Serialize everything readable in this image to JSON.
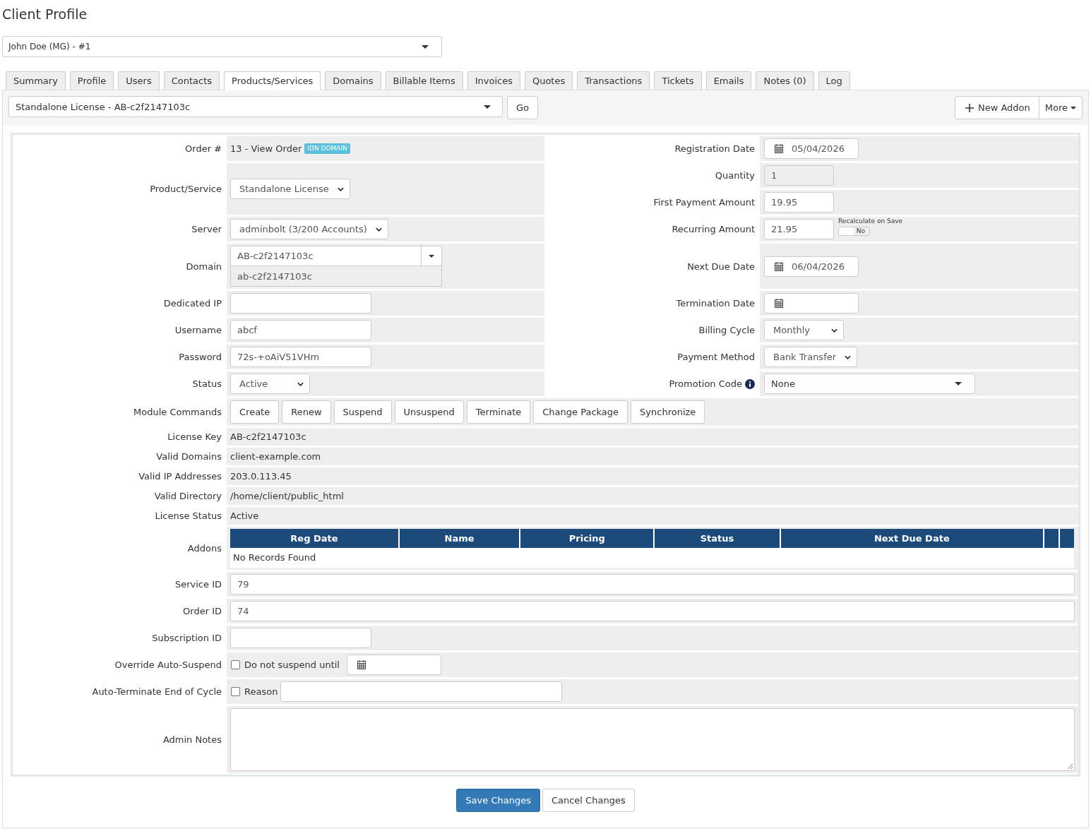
{
  "page_title": "Client Profile",
  "client_select": {
    "value": "John Doe (MG) - #1"
  },
  "tabs": [
    {
      "label": "Summary",
      "selected": false
    },
    {
      "label": "Profile",
      "selected": false
    },
    {
      "label": "Users",
      "selected": false
    },
    {
      "label": "Contacts",
      "selected": false
    },
    {
      "label": "Products/Services",
      "selected": true
    },
    {
      "label": "Domains",
      "selected": false
    },
    {
      "label": "Billable Items",
      "selected": false
    },
    {
      "label": "Invoices",
      "selected": false
    },
    {
      "label": "Quotes",
      "selected": false
    },
    {
      "label": "Transactions",
      "selected": false
    },
    {
      "label": "Tickets",
      "selected": false
    },
    {
      "label": "Emails",
      "selected": false
    },
    {
      "label": "Notes (0)",
      "selected": false
    },
    {
      "label": "Log",
      "selected": false
    }
  ],
  "service_bar": {
    "service_select": {
      "value": "Standalone License - AB-c2f2147103c"
    },
    "go_button": "Go",
    "new_addon_button": "New Addon",
    "more_button": "More"
  },
  "form": {
    "paired_rows": [
      {
        "left": {
          "label": "Order #",
          "kind": "order",
          "value": "13 -",
          "link": "View Order",
          "badge": "IDN DOMAIN"
        },
        "right": [
          {
            "label": "Registration Date",
            "kind": "date",
            "value": "05/04/2026"
          }
        ]
      },
      {
        "left": {
          "label": "Product/Service",
          "kind": "select",
          "value": "Standalone License"
        },
        "right": [
          {
            "label": "Quantity",
            "kind": "amount",
            "value": "1",
            "disabled": true
          },
          {
            "label": "First Payment Amount",
            "kind": "amount",
            "value": "19.95",
            "disabled": false
          }
        ]
      },
      {
        "left": {
          "label": "Server",
          "kind": "select",
          "value": "adminbolt (3/200 Accounts)"
        },
        "right": [
          {
            "label": "Recurring Amount",
            "kind": "amount",
            "value": "21.95",
            "disabled": false,
            "recalculate": {
              "label": "Recalculate on Save",
              "on": false,
              "state_text": "No"
            }
          }
        ]
      },
      {
        "left": {
          "label": "Domain",
          "kind": "domain",
          "value": "AB-c2f2147103c",
          "secondary_value": "ab-c2f2147103c"
        },
        "right": [
          {
            "label": "Next Due Date",
            "kind": "date",
            "value": "06/04/2026"
          }
        ]
      },
      {
        "left": {
          "label": "Dedicated IP",
          "kind": "text"
        },
        "right": [
          {
            "label": "Termination Date",
            "kind": "date"
          }
        ]
      },
      {
        "left": {
          "label": "Username",
          "kind": "text",
          "value": "abcf"
        },
        "right": [
          {
            "label": "Billing Cycle",
            "kind": "select",
            "value": "Monthly"
          }
        ]
      },
      {
        "left": {
          "label": "Password",
          "kind": "text",
          "value": "72s-+oAiV51VHm"
        },
        "right": [
          {
            "label": "Payment Method",
            "kind": "select",
            "value": "Bank Transfer"
          }
        ]
      },
      {
        "left": {
          "label": "Status",
          "kind": "select",
          "value": "Active"
        },
        "right": [
          {
            "label": "Promotion Code",
            "kind": "dropdown",
            "value": "None",
            "help_icon": true
          }
        ]
      }
    ],
    "full_rows": [
      {
        "label": "Module Commands",
        "kind": "buttons",
        "buttons": [
          "Create",
          "Renew",
          "Suspend",
          "Unsuspend",
          "Terminate",
          "Change Package",
          "Synchronize"
        ]
      },
      {
        "label": "License Key",
        "kind": "static",
        "value": "AB-c2f2147103c"
      },
      {
        "label": "Valid Domains",
        "kind": "static",
        "value": "client-example.com"
      },
      {
        "label": "Valid IP Addresses",
        "kind": "static",
        "value": "203.0.113.45"
      },
      {
        "label": "Valid Directory",
        "kind": "static",
        "value": "/home/client/public_html"
      },
      {
        "label": "License Status",
        "kind": "static",
        "value": "Active"
      },
      {
        "label": "Addons",
        "kind": "table",
        "columns": [
          "Reg Date",
          "Name",
          "Pricing",
          "Status",
          "Next Due Date"
        ],
        "empty_message": "No Records Found"
      },
      {
        "label": "Service ID",
        "kind": "wide-text",
        "value": "79"
      },
      {
        "label": "Order ID",
        "kind": "wide-text",
        "value": "74"
      },
      {
        "label": "Subscription ID",
        "kind": "text"
      },
      {
        "label": "Override Auto-Suspend",
        "kind": "check-date",
        "checked": false,
        "option_label": "Do not suspend until"
      },
      {
        "label": "Auto-Terminate End of Cycle",
        "kind": "check-text",
        "checked": false,
        "option_label": "Reason"
      },
      {
        "label": "Admin Notes",
        "kind": "notes"
      }
    ]
  },
  "actions": {
    "save_button": "Save Changes",
    "cancel_button": "Cancel Changes"
  }
}
